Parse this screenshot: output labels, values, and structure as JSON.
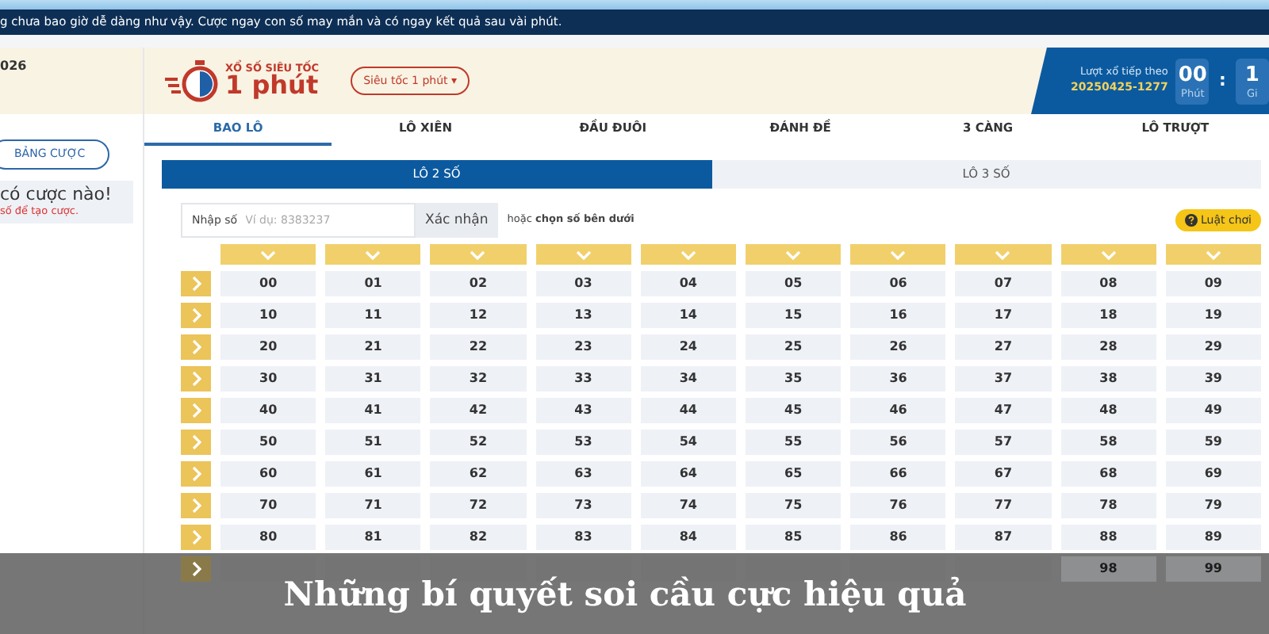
{
  "marquee": "g chưa bao giờ dễ dàng như vậy. Cược ngay con số may mắn và có ngay kết quả sau vài phút.",
  "sidebar": {
    "date_fragment": "026",
    "bet_button": "BẢNG CƯỢC",
    "empty_title": "có cược nào!",
    "empty_hint": "số để tạo cược."
  },
  "header": {
    "logo_small": "XỔ SỐ SIÊU TỐC",
    "logo_big": "1 phút",
    "mode_dropdown": "Siêu tốc 1 phút",
    "dropdown_caret": "▾",
    "next_draw_label": "Lượt xổ tiếp theo",
    "next_draw_id": "20250425-1277",
    "countdown": [
      {
        "value": "00",
        "unit": "Phút"
      },
      {
        "value": "1",
        "unit": "Gi"
      }
    ],
    "separator": ":"
  },
  "tabs": [
    {
      "label": "BAO LÔ",
      "selected": true
    },
    {
      "label": "LÔ XIÊN",
      "selected": false
    },
    {
      "label": "ĐẦU ĐUÔI",
      "selected": false
    },
    {
      "label": "ĐÁNH ĐỀ",
      "selected": false
    },
    {
      "label": "3 CÀNG",
      "selected": false
    },
    {
      "label": "LÔ TRƯỢT",
      "selected": false
    }
  ],
  "subtabs": [
    {
      "label": "LÔ 2 SỐ",
      "selected": true
    },
    {
      "label": "LÔ 3 SỐ",
      "selected": false
    }
  ],
  "entry": {
    "label": "Nhập số",
    "placeholder": "Ví dụ: 8383237",
    "confirm": "Xác nhận",
    "hint": "hoặc **chọn số bên dưới**",
    "rules": "Luật chơi"
  },
  "grid": [
    {
      "cells": [
        "00",
        "01",
        "02",
        "03",
        "04",
        "05",
        "06",
        "07",
        "08",
        "09"
      ]
    },
    {
      "cells": [
        "10",
        "11",
        "12",
        "13",
        "14",
        "15",
        "16",
        "17",
        "18",
        "19"
      ]
    },
    {
      "cells": [
        "20",
        "21",
        "22",
        "23",
        "24",
        "25",
        "26",
        "27",
        "28",
        "29"
      ]
    },
    {
      "cells": [
        "30",
        "31",
        "32",
        "33",
        "34",
        "35",
        "36",
        "37",
        "38",
        "39"
      ]
    },
    {
      "cells": [
        "40",
        "41",
        "42",
        "43",
        "44",
        "45",
        "46",
        "47",
        "48",
        "49"
      ]
    },
    {
      "cells": [
        "50",
        "51",
        "52",
        "53",
        "54",
        "55",
        "56",
        "57",
        "58",
        "59"
      ]
    },
    {
      "cells": [
        "60",
        "61",
        "62",
        "63",
        "64",
        "65",
        "66",
        "67",
        "68",
        "69"
      ]
    },
    {
      "cells": [
        "70",
        "71",
        "72",
        "73",
        "74",
        "75",
        "76",
        "77",
        "78",
        "79"
      ]
    },
    {
      "cells": [
        "80",
        "81",
        "82",
        "83",
        "84",
        "85",
        "86",
        "87",
        "88",
        "89"
      ]
    },
    {
      "cells": [
        null,
        null,
        null,
        null,
        null,
        null,
        null,
        null,
        "98",
        "99"
      ]
    }
  ],
  "caption": "Những bí quyết soi cầu cực hiệu quả"
}
